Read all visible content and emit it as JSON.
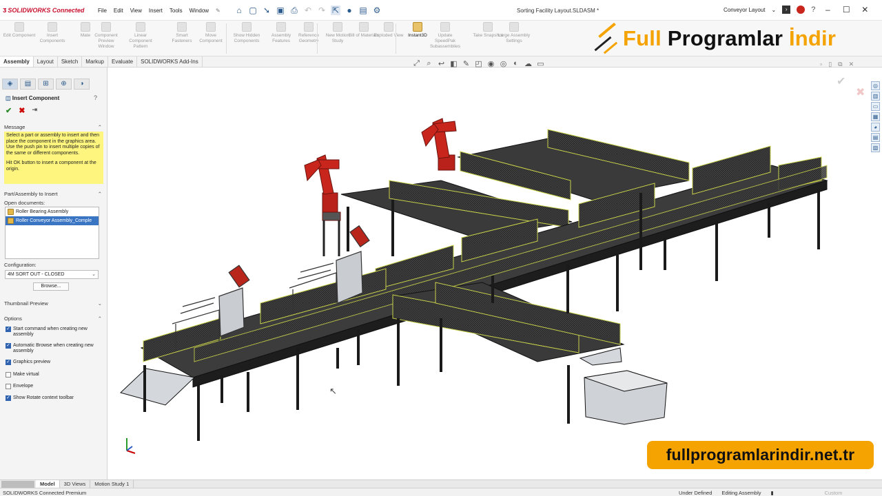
{
  "app": {
    "brand": "SOLIDWORKS Connected",
    "doc_title": "Sorting Facility Layout.SLDASM *",
    "config_label": "Conveyor Layout"
  },
  "menu": [
    "File",
    "Edit",
    "View",
    "Insert",
    "Tools",
    "Window"
  ],
  "commands": [
    {
      "label": "Edit Component",
      "active": false
    },
    {
      "label": "Insert Components",
      "active": false
    },
    {
      "label": "Mate",
      "active": false
    },
    {
      "label": "Component Preview Window",
      "active": false
    },
    {
      "label": "Linear Component Pattern",
      "active": false
    },
    {
      "label": "Smart Fasteners",
      "active": false
    },
    {
      "label": "Move Component",
      "active": false
    },
    {
      "label": "Show Hidden Components",
      "active": false
    },
    {
      "label": "Assembly Features",
      "active": false
    },
    {
      "label": "Reference Geometry",
      "active": false
    },
    {
      "label": "New Motion Study",
      "active": false
    },
    {
      "label": "Bill of Materials",
      "active": false
    },
    {
      "label": "Exploded View",
      "active": false
    },
    {
      "label": "Instant3D",
      "active": true
    },
    {
      "label": "Update SpeedPak Subassemblies",
      "active": false
    },
    {
      "label": "Take Snapshot",
      "active": false
    },
    {
      "label": "Large Assembly Settings",
      "active": false
    }
  ],
  "tabs": [
    "Assembly",
    "Layout",
    "Sketch",
    "Markup",
    "Evaluate",
    "SOLIDWORKS Add-Ins"
  ],
  "panel": {
    "title": "Insert Component",
    "message_header": "Message",
    "message_p1": "Select a part or assembly to insert and then place the component in the graphics area. Use the push pin to insert multiple copies of the same or different components.",
    "message_p2": "Hit OK button to insert a component at the origin.",
    "part_header": "Part/Assembly to Insert",
    "open_docs_label": "Open documents:",
    "open_docs": [
      "Roller Bearing Assembly",
      "Roller Conveyor Assembly_Comple"
    ],
    "selected_doc_index": 1,
    "config_label": "Configuration:",
    "config_value": "4M SORT OUT - CLOSED",
    "browse": "Browse...",
    "thumb_header": "Thumbnail Preview",
    "options_header": "Options",
    "options": [
      {
        "label": "Start command when creating new assembly",
        "checked": true
      },
      {
        "label": "Automatic Browse when creating new assembly",
        "checked": true
      },
      {
        "label": "Graphics preview",
        "checked": true
      },
      {
        "label": "Make virtual",
        "checked": false
      },
      {
        "label": "Envelope",
        "checked": false
      },
      {
        "label": "Show Rotate context toolbar",
        "checked": true
      }
    ]
  },
  "watermark": {
    "part1": "Full",
    "part2": "Programlar",
    "part3": "İndir",
    "site": "fullprogramlarindir.net.tr"
  },
  "bottom_tabs": [
    "Model",
    "3D Views",
    "Motion Study 1"
  ],
  "status": {
    "left": "SOLIDWORKS Connected Premium",
    "def": "Under Defined",
    "mode": "Editing Assembly",
    "units": "Custom"
  },
  "colors": {
    "accent_orange": "#f4a300",
    "robot_red": "#c8261c",
    "highlight_yellow": "#fdf57e",
    "selection_blue": "#3a75c4"
  }
}
